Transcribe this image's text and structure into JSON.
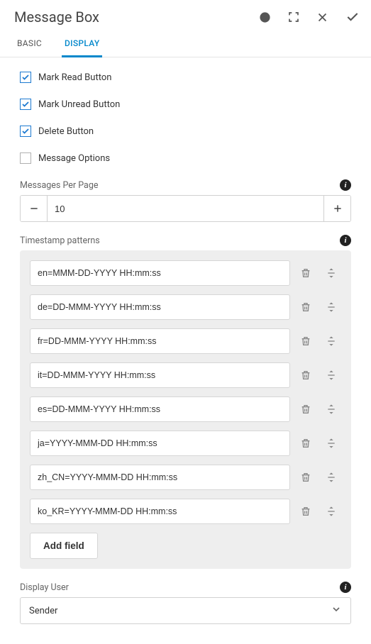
{
  "header": {
    "title": "Message Box"
  },
  "tabs": {
    "basic": "BASIC",
    "display": "DISPLAY"
  },
  "checkboxes": {
    "markRead": {
      "label": "Mark Read Button",
      "checked": true
    },
    "markUnread": {
      "label": "Mark Unread Button",
      "checked": true
    },
    "delete": {
      "label": "Delete Button",
      "checked": true
    },
    "messageOptions": {
      "label": "Message Options",
      "checked": false
    }
  },
  "messagesPerPage": {
    "label": "Messages Per Page",
    "value": "10"
  },
  "timestampPatterns": {
    "label": "Timestamp patterns",
    "items": [
      "en=MMM-DD-YYYY HH:mm:ss",
      "de=DD-MMM-YYYY HH:mm:ss",
      "fr=DD-MMM-YYYY HH:mm:ss",
      "it=DD-MMM-YYYY HH:mm:ss",
      "es=DD-MMM-YYYY HH:mm:ss",
      "ja=YYYY-MMM-DD HH:mm:ss",
      "zh_CN=YYYY-MMM-DD HH:mm:ss",
      "ko_KR=YYYY-MMM-DD HH:mm:ss"
    ],
    "addFieldLabel": "Add field"
  },
  "displayUser": {
    "label": "Display User",
    "value": "Sender"
  }
}
